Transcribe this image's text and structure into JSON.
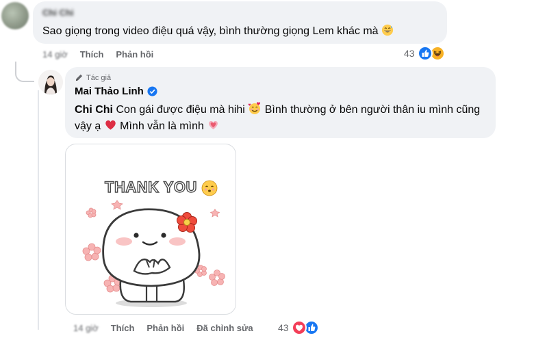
{
  "comment1": {
    "author": "Chi Chi",
    "text": "Sao giọng trong video điệu quá vậy, bình thường giọng Lem khác mà",
    "emoji": "grinning-sweat-emoji",
    "time": "14 giờ",
    "like_label": "Thích",
    "reply_label": "Phản hồi",
    "reaction_count": "43",
    "reactions": [
      "like",
      "haha"
    ]
  },
  "reply": {
    "author_tag": "Tác giả",
    "author": "Mai Thảo Linh",
    "mention": "Chi Chi",
    "text_part1": " Con gái được điệu mà hihi",
    "text_part2": " Bình thường ở bên người thân iu mình cũng vậy ạ",
    "text_part3": " Mình vẫn là mình",
    "sticker_text": "THANK YOU",
    "time": "14 giờ",
    "like_label": "Thích",
    "reply_label": "Phản hồi",
    "edited_label": "Đã chỉnh sửa",
    "reaction_count": "43",
    "reactions": [
      "love",
      "like"
    ]
  },
  "colors": {
    "bubble": "#f0f2f5",
    "like_blue": "#1877f2",
    "love_red": "#f33e58",
    "haha_yellow": "#f7b125",
    "meta_gray": "#65676b"
  }
}
